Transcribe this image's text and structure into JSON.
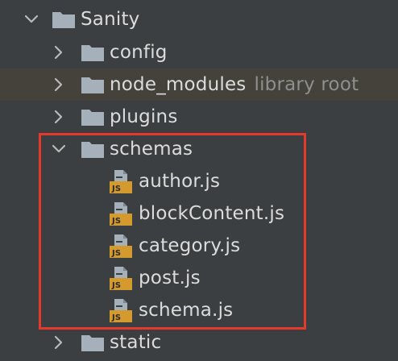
{
  "tree": {
    "root": {
      "label": "Sanity",
      "expanded": true
    },
    "folders": [
      {
        "label": "config",
        "expanded": false
      },
      {
        "label": "node_modules",
        "hint": "library root",
        "expanded": false
      },
      {
        "label": "plugins",
        "expanded": false
      },
      {
        "label": "schemas",
        "expanded": true
      },
      {
        "label": "static",
        "expanded": false
      }
    ],
    "schema_files": [
      {
        "label": "author.js",
        "badge": "JS"
      },
      {
        "label": "blockContent.js",
        "badge": "JS"
      },
      {
        "label": "category.js",
        "badge": "JS"
      },
      {
        "label": "post.js",
        "badge": "JS"
      },
      {
        "label": "schema.js",
        "badge": "JS"
      }
    ]
  },
  "colors": {
    "background": "#3c3f41",
    "highlight_row": "#45423b",
    "annotation_box": "#e53a2b",
    "js_badge": "#d49a2e",
    "folder": "#a6b0ba"
  },
  "icons": {
    "collapsed": "chevron-right-icon",
    "expanded": "chevron-down-icon",
    "folder": "folder-icon",
    "file": "js-file-icon"
  }
}
